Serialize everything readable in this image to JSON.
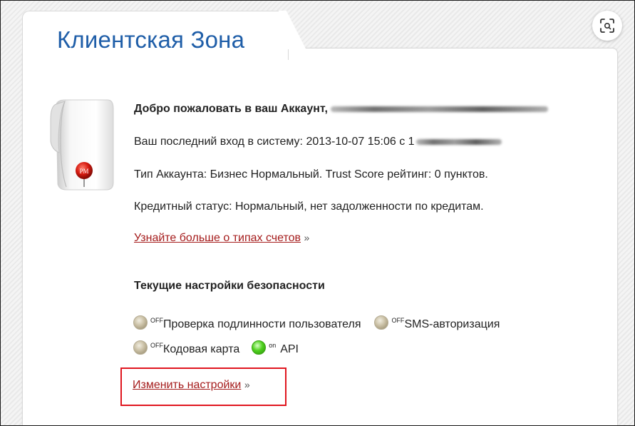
{
  "header": {
    "title": "Клиентская Зона"
  },
  "account": {
    "welcome_text": "Добро пожаловать в ваш Аккаунт,",
    "last_login_prefix": "Ваш последний вход в систему: 2013-10-07 15:06 с 1",
    "account_type": "Тип Аккаунта: Бизнес Нормальный. Trust Score рейтинг: 0 пунктов.",
    "credit_status": "Кредитный статус: Нормальный, нет задолженности по кредитам.",
    "learn_more_link": "Узнайте больше о типах счетов",
    "learn_more_arrow": "»"
  },
  "security": {
    "heading": "Текущие настройки безопасности",
    "items": [
      {
        "state": "OFF",
        "label": "Проверка подлинности пользователя",
        "enabled": false
      },
      {
        "state": "OFF",
        "label": "SMS-авторизация",
        "enabled": false
      },
      {
        "state": "OFF",
        "label": "Кодовая карта",
        "enabled": false
      },
      {
        "state": "on",
        "label": "API",
        "enabled": true
      }
    ],
    "change_link": "Изменить настройки",
    "change_arrow": "»"
  },
  "avatar": {
    "badge_text": "PM"
  },
  "colors": {
    "title": "#1f5ea8",
    "link": "#a51c1c",
    "highlight": "#e0161f",
    "on_indicator": "#4fd11e",
    "off_indicator": "#c9bfa4"
  }
}
